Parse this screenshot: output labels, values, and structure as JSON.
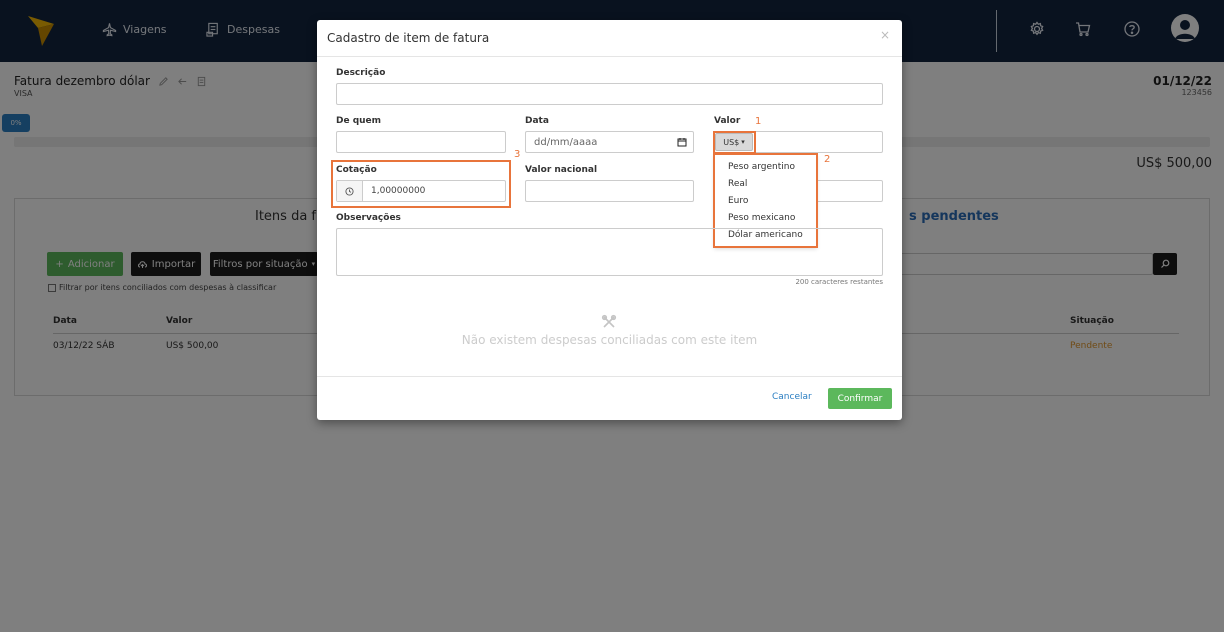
{
  "nav": {
    "items": [
      {
        "label": "Viagens",
        "icon": "airplane-icon"
      },
      {
        "label": "Despesas",
        "icon": "receipt-icon"
      }
    ],
    "right_icons": [
      "gear-icon",
      "cart-icon",
      "help-icon",
      "user-avatar-icon"
    ]
  },
  "page": {
    "title": "Fatura dezembro dólar",
    "subtitle": "VISA",
    "date": "01/12/22",
    "number": "123456",
    "progress_label": "0%",
    "progress_percent": 0,
    "total": "US$ 500,00"
  },
  "card": {
    "heading_left": "Itens da f",
    "heading_right": "s pendentes",
    "add_label": "Adicionar",
    "import_label": "Importar",
    "filter_label": "Filtros por situação",
    "filter_checkbox": "Filtrar por itens conciliados com despesas à classificar",
    "columns": {
      "date": "Data",
      "value": "Valor",
      "status": "Situação"
    },
    "row": {
      "date": "03/12/22 SÁB",
      "value": "US$ 500,00",
      "status": "Pendente"
    }
  },
  "modal": {
    "title": "Cadastro de item de fatura",
    "close": "×",
    "labels": {
      "descricao": "Descrição",
      "de_quem": "De quem",
      "data": "Data",
      "valor": "Valor",
      "cotacao": "Cotação",
      "valor_nacional": "Valor nacional",
      "observacoes": "Observações"
    },
    "date_placeholder": "dd/mm/aaaa",
    "currency_selected": "US$",
    "currency_options": [
      "Peso argentino",
      "Real",
      "Euro",
      "Peso mexicano",
      "Dólar americano"
    ],
    "cotacao_value": "1,00000000",
    "counter": "200 caracteres restantes",
    "empty_text": "Não existem despesas conciliadas com este item",
    "cancel_label": "Cancelar",
    "confirm_label": "Confirmar"
  },
  "annotations": {
    "one": "1",
    "two": "2",
    "three": "3"
  },
  "colors": {
    "topbar": "#13253f",
    "accent_blue": "#2a7ec2",
    "success_green": "#5cb85c",
    "highlight_orange": "#e8743b",
    "pending_orange": "#e0962c"
  }
}
